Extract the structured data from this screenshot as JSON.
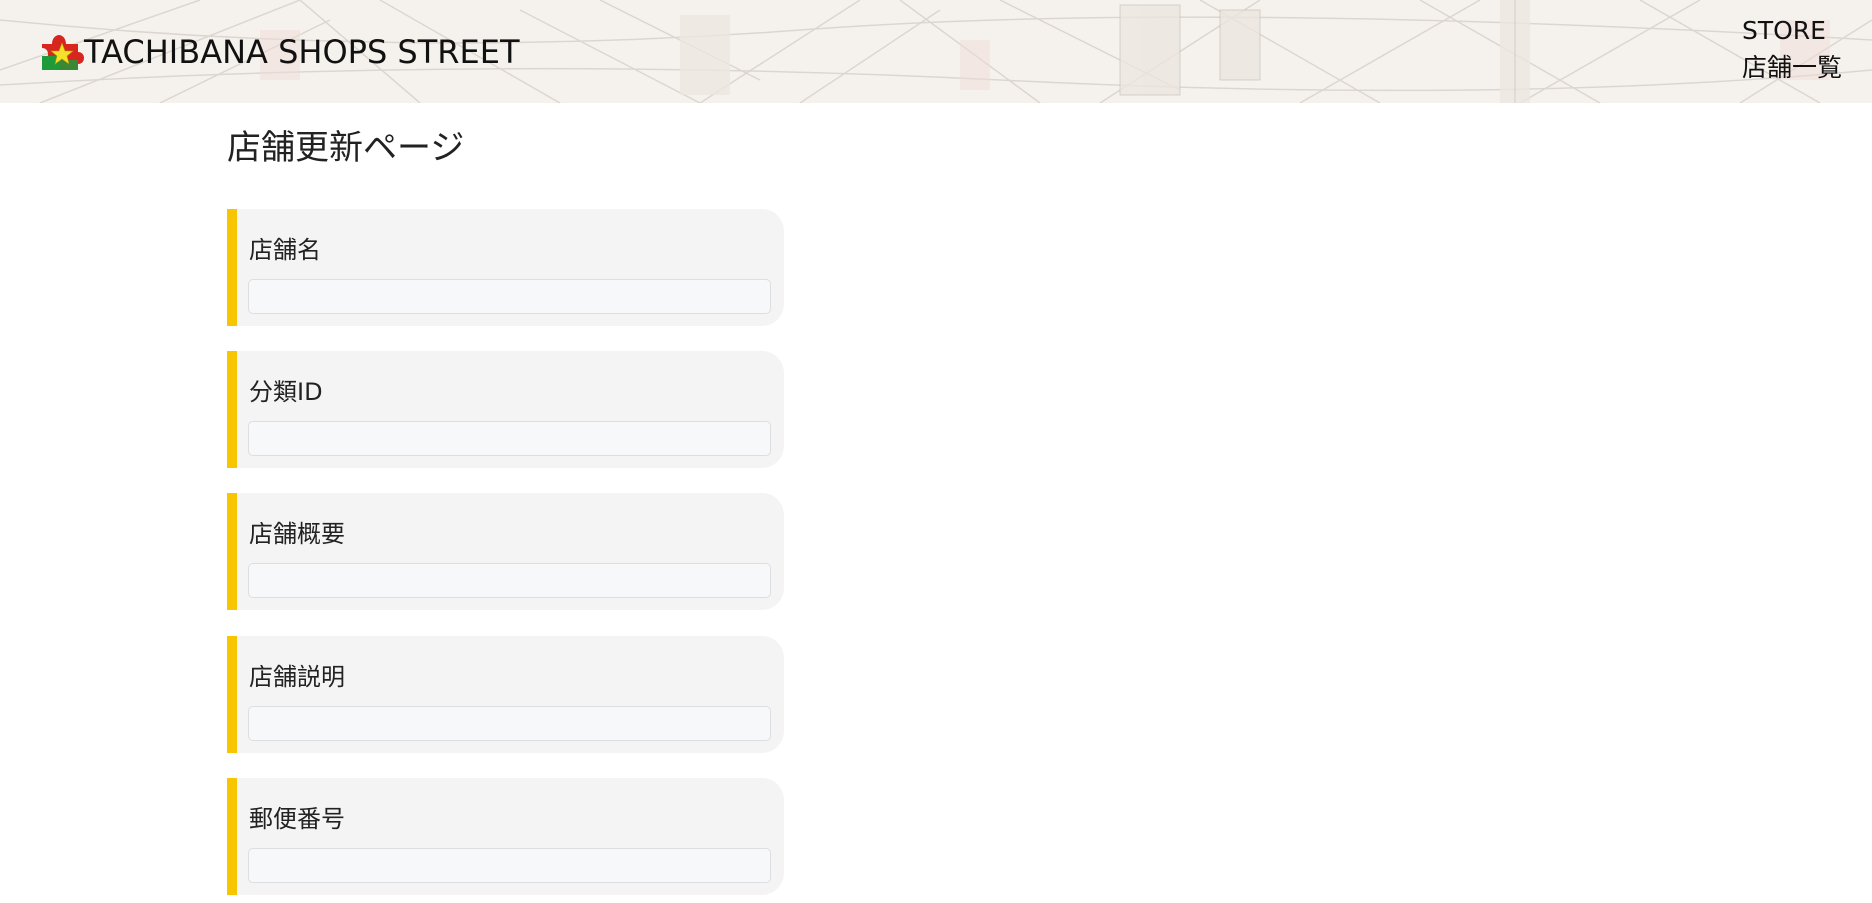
{
  "header": {
    "brand_name": "TACHIBANA SHOPS STREET",
    "logo_icon": "puzzle-star-logo-icon",
    "nav": [
      {
        "label": "STORE"
      },
      {
        "label": "店舗一覧"
      }
    ]
  },
  "main": {
    "title": "店舗更新ページ",
    "fields": [
      {
        "label": "店舗名",
        "value": "",
        "placeholder": ""
      },
      {
        "label": "分類ID",
        "value": "",
        "placeholder": ""
      },
      {
        "label": "店舗概要",
        "value": "",
        "placeholder": ""
      },
      {
        "label": "店舗説明",
        "value": "",
        "placeholder": ""
      },
      {
        "label": "郵便番号",
        "value": "",
        "placeholder": ""
      }
    ]
  },
  "colors": {
    "accent": "#f7c600",
    "card_background": "#f4f4f4",
    "logo_red": "#d7261e",
    "logo_green": "#1f9a3a",
    "logo_yellow": "#f3e12a"
  }
}
